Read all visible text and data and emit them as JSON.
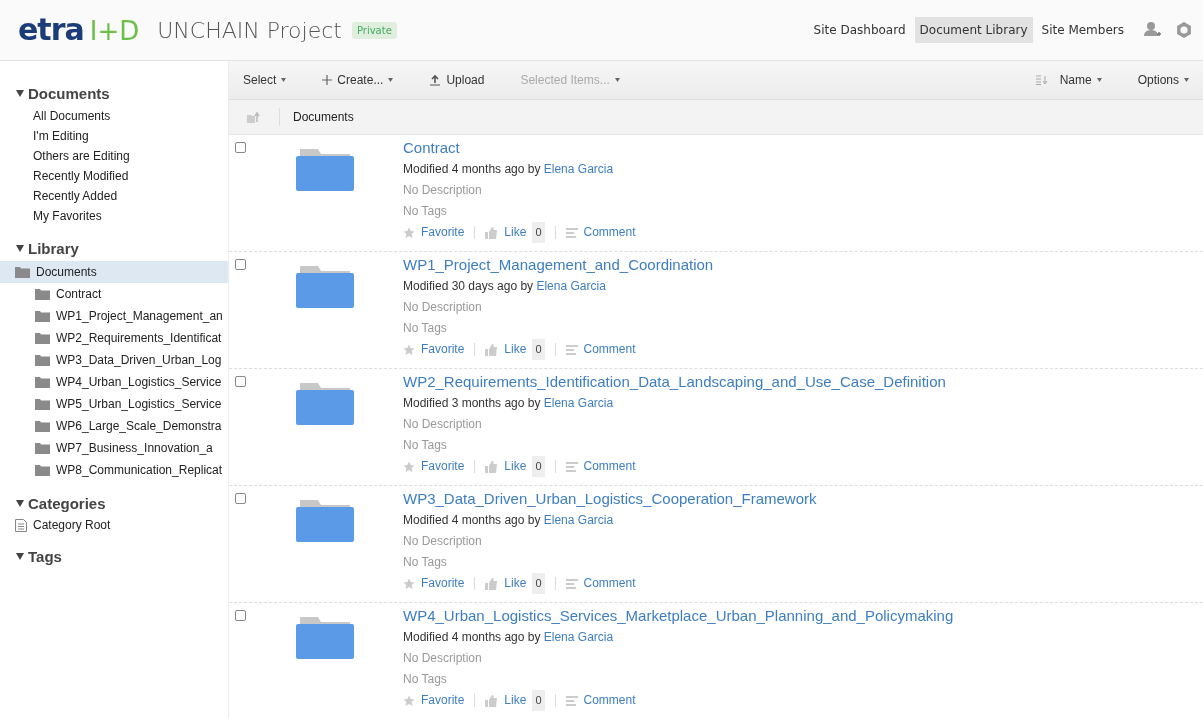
{
  "header": {
    "logo": {
      "main": "etra",
      "suffix": "I+D"
    },
    "site_title": "UNCHAIN Project",
    "visibility_badge": "Private",
    "nav": [
      {
        "label": "Site Dashboard",
        "selected": false
      },
      {
        "label": "Document Library",
        "selected": true
      },
      {
        "label": "Site Members",
        "selected": false
      }
    ]
  },
  "sidebar": {
    "sections": [
      {
        "title": "Documents",
        "expanded": true,
        "kind": "links",
        "items": [
          {
            "label": "All Documents"
          },
          {
            "label": "I'm Editing"
          },
          {
            "label": "Others are Editing"
          },
          {
            "label": "Recently Modified"
          },
          {
            "label": "Recently Added"
          },
          {
            "label": "My Favorites"
          }
        ]
      },
      {
        "title": "Library",
        "expanded": true,
        "kind": "tree",
        "items": [
          {
            "label": "Documents",
            "selected": true,
            "children": [
              {
                "label": "Contract",
                "selected": false
              },
              {
                "label": "WP1_Project_Management_an",
                "selected": false
              },
              {
                "label": "WP2_Requirements_Identificat",
                "selected": false
              },
              {
                "label": "WP3_Data_Driven_Urban_Log",
                "selected": false
              },
              {
                "label": "WP4_Urban_Logistics_Service",
                "selected": false
              },
              {
                "label": "WP5_Urban_Logistics_Service",
                "selected": false
              },
              {
                "label": "WP6_Large_Scale_Demonstra",
                "selected": false
              },
              {
                "label": "WP7_Business_Innovation_a",
                "selected": false
              },
              {
                "label": "WP8_Communication_Replicat",
                "selected": false
              }
            ]
          }
        ]
      },
      {
        "title": "Categories",
        "expanded": true,
        "kind": "categories",
        "items": [
          {
            "label": "Category Root"
          }
        ]
      },
      {
        "title": "Tags",
        "expanded": true,
        "kind": "links"
      }
    ]
  },
  "toolbar": {
    "left": [
      {
        "label": "Select",
        "kind": "menu",
        "disabled": false
      },
      {
        "label": "Create...",
        "kind": "create",
        "disabled": false
      },
      {
        "label": "Upload",
        "kind": "upload",
        "disabled": false
      },
      {
        "label": "Selected Items...",
        "kind": "menu",
        "disabled": true
      }
    ],
    "sort": "Name",
    "options": "Options"
  },
  "breadcrumb": "Documents",
  "rows": [
    {
      "name": "Contract",
      "checked": false,
      "modified": "Modified 4 months ago by",
      "author": "Elena Garcia",
      "description": "No Description",
      "tags": "No Tags",
      "favorite": "Favorite",
      "like": "Like",
      "like_count": "0",
      "comment": "Comment"
    },
    {
      "name": "WP1_Project_Management_and_Coordination",
      "checked": false,
      "modified": "Modified 30 days ago by",
      "author": "Elena Garcia",
      "description": "No Description",
      "tags": "No Tags",
      "favorite": "Favorite",
      "like": "Like",
      "like_count": "0",
      "comment": "Comment"
    },
    {
      "name": "WP2_Requirements_Identification_Data_Landscaping_and_Use_Case_Definition",
      "checked": false,
      "modified": "Modified 3 months ago by",
      "author": "Elena Garcia",
      "description": "No Description",
      "tags": "No Tags",
      "favorite": "Favorite",
      "like": "Like",
      "like_count": "0",
      "comment": "Comment"
    },
    {
      "name": "WP3_Data_Driven_Urban_Logistics_Cooperation_Framework",
      "checked": false,
      "modified": "Modified 4 months ago by",
      "author": "Elena Garcia",
      "description": "No Description",
      "tags": "No Tags",
      "favorite": "Favorite",
      "like": "Like",
      "like_count": "0",
      "comment": "Comment"
    },
    {
      "name": "WP4_Urban_Logistics_Services_Marketplace_Urban_Planning_and_Policymaking",
      "checked": false,
      "modified": "Modified 4 months ago by",
      "author": "Elena Garcia",
      "description": "No Description",
      "tags": "No Tags",
      "favorite": "Favorite",
      "like": "Like",
      "like_count": "0",
      "comment": "Comment"
    }
  ]
}
